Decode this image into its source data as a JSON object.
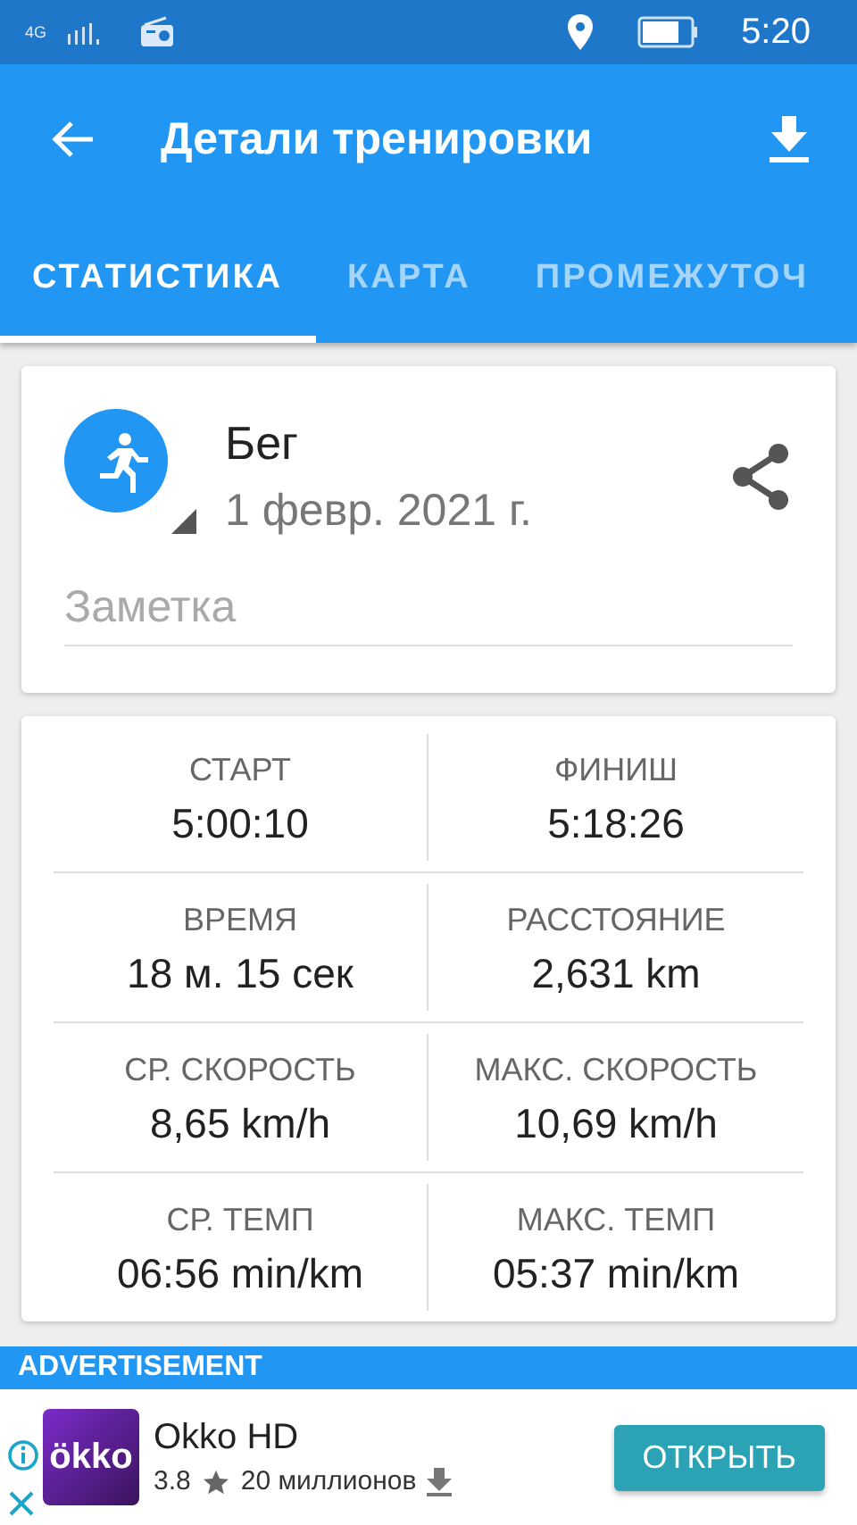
{
  "status_bar": {
    "network": "4G",
    "time": "5:20"
  },
  "toolbar": {
    "title": "Детали тренировки"
  },
  "tabs": [
    {
      "label": "СТАТИСТИКА",
      "selected": true
    },
    {
      "label": "КАРТА",
      "selected": false
    },
    {
      "label": "ПРОМЕЖУТОЧ",
      "selected": false
    }
  ],
  "activity": {
    "name": "Бег",
    "date": "1 февр. 2021 г.",
    "note_placeholder": "Заметка"
  },
  "stats": [
    {
      "label": "СТАРТ",
      "value": "5:00:10"
    },
    {
      "label": "ФИНИШ",
      "value": "5:18:26"
    },
    {
      "label": "ВРЕМЯ",
      "value": "18 м. 15 сек"
    },
    {
      "label": "РАССТОЯНИЕ",
      "value": "2,631 km"
    },
    {
      "label": "СР. СКОРОСТЬ",
      "value": "8,65 km/h"
    },
    {
      "label": "МАКС. СКОРОСТЬ",
      "value": "10,69 km/h"
    },
    {
      "label": "СР. ТЕМП",
      "value": "06:56 min/km"
    },
    {
      "label": "МАКС. ТЕМП",
      "value": "05:37 min/km"
    }
  ],
  "ad": {
    "header": "ADVERTISEMENT",
    "app_name": "Okko HD",
    "logo_text": "ökko",
    "rating": "3.8",
    "downloads": "20 миллионов",
    "button": "ОТКРЫТЬ"
  }
}
